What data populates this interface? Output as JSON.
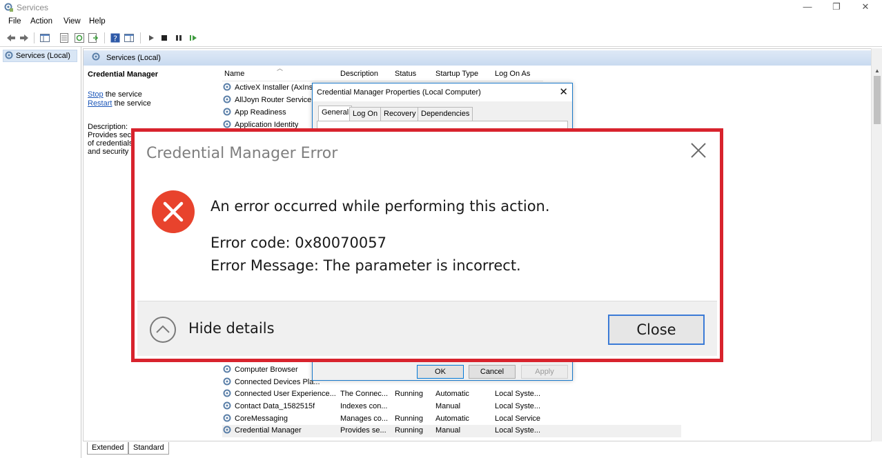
{
  "window": {
    "title": "Services",
    "controls": {
      "minimize": "—",
      "restore": "❐",
      "close": "✕"
    }
  },
  "menu": [
    "File",
    "Action",
    "View",
    "Help"
  ],
  "tree": {
    "item": "Services (Local)"
  },
  "panel": {
    "header": "Services (Local)",
    "detail": {
      "title": "Credential Manager",
      "stop_link": "Stop",
      "stop_rest": " the service",
      "restart_link": "Restart",
      "restart_rest": " the service",
      "description_label": "Description:",
      "description_lines": [
        "Provides secu",
        "of credentials",
        "and security"
      ]
    },
    "columns": [
      "Name",
      "Description",
      "Status",
      "Startup Type",
      "Log On As"
    ],
    "rows_top": [
      {
        "name": "ActiveX Installer (AxIns"
      },
      {
        "name": "AllJoyn Router Service"
      },
      {
        "name": "App Readiness"
      },
      {
        "name": "Application Identity"
      }
    ],
    "rows_bottom": [
      {
        "name": "Computer Browser",
        "description": "",
        "status": "",
        "startup": "",
        "logon": ""
      },
      {
        "name": "Connected Devices Pla...",
        "description": "",
        "status": "",
        "startup": "",
        "logon": ""
      },
      {
        "name": "Connected User Experience...",
        "description": "The Connec...",
        "status": "Running",
        "startup": "Automatic",
        "logon": "Local Syste..."
      },
      {
        "name": "Contact Data_1582515f",
        "description": "Indexes con...",
        "status": "",
        "startup": "Manual",
        "logon": "Local Syste..."
      },
      {
        "name": "CoreMessaging",
        "description": "Manages co...",
        "status": "Running",
        "startup": "Automatic",
        "logon": "Local Service"
      },
      {
        "name": "Credential Manager",
        "description": "Provides se...",
        "status": "Running",
        "startup": "Manual",
        "logon": "Local Syste..."
      }
    ],
    "bottom_tabs": [
      "Extended",
      "Standard"
    ]
  },
  "properties": {
    "title": "Credential Manager Properties (Local Computer)",
    "tabs": [
      "General",
      "Log On",
      "Recovery",
      "Dependencies"
    ],
    "buttons": {
      "ok": "OK",
      "cancel": "Cancel",
      "apply": "Apply"
    }
  },
  "error": {
    "title": "Credential Manager Error",
    "main": "An error occurred while performing this action.",
    "code": "Error code: 0x80070057",
    "message": "Error Message: The parameter is incorrect.",
    "hide_details": "Hide details",
    "close": "Close",
    "highlight_color": "#d8232d",
    "icon_color": "#e8432d"
  }
}
